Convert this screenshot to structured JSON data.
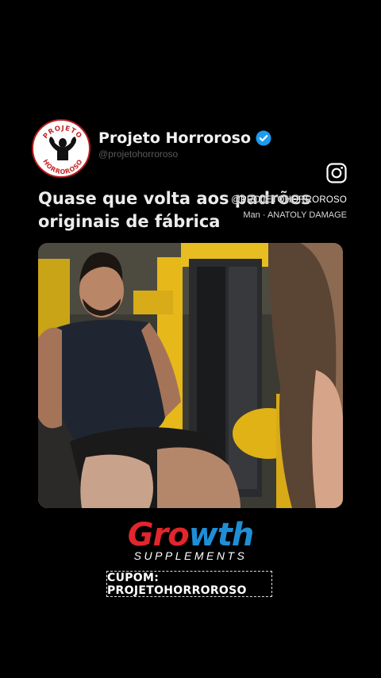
{
  "post": {
    "account_name": "Projeto Horroroso",
    "handle": "@projetohorroroso",
    "avatar_text_top": "PROJETO",
    "avatar_text_bottom": "HORROROSO",
    "caption_line1": "Quase que volta aos padrões",
    "caption_line2": "originais de fábrica"
  },
  "overlay": {
    "username": "@PROJETOHORROROSO",
    "audio": "Man · ANATOLY DAMAGE",
    "icon": "instagram-icon"
  },
  "ad": {
    "brand_main_1": "Gro",
    "brand_main_2": "wth",
    "brand_sub": "SUPPLEMENTS",
    "coupon": "CUPOM: PROJETOHORROROSO"
  },
  "colors": {
    "background": "#000000",
    "verified": "#1d9bf0",
    "brand_red": "#e3262c",
    "brand_blue": "#1e8fd6",
    "gym_yellow": "#f2c21b"
  }
}
